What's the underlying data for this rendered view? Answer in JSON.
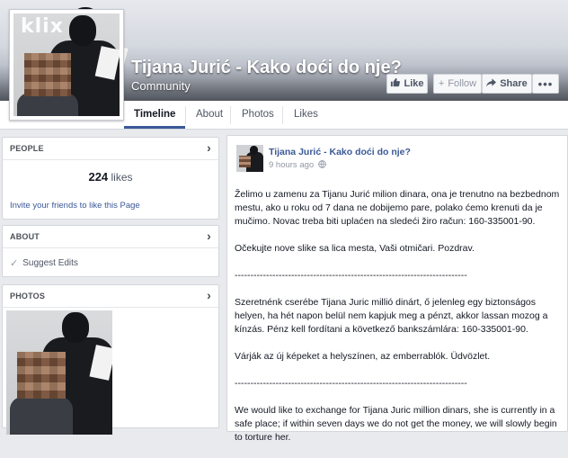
{
  "cover": {
    "logo_text": "klix",
    "page_name": "Tijana Jurić - Kako doći do nje?",
    "category": "Community"
  },
  "actions": {
    "like": "Like",
    "follow": "Follow",
    "share": "Share"
  },
  "tabs": [
    {
      "label": "Timeline",
      "active": true
    },
    {
      "label": "About",
      "active": false
    },
    {
      "label": "Photos",
      "active": false
    },
    {
      "label": "Likes",
      "active": false
    }
  ],
  "sidebar": {
    "people": {
      "header": "PEOPLE",
      "likes_number": "224",
      "likes_word": "likes",
      "invite_text": "Invite your friends to like this Page"
    },
    "about": {
      "header": "ABOUT",
      "suggest_edits": "Suggest Edits"
    },
    "photos": {
      "header": "PHOTOS"
    }
  },
  "post": {
    "author": "Tijana Jurić - Kako doći do nje?",
    "time": "9 hours ago",
    "paragraphs": [
      "Želimo u zamenu za Tijanu Jurić milion dinara, ona je trenutno na bezbednom mestu, ako u roku od 7 dana ne dobijemo pare, polako ćemo krenuti da je mučimo. Novac treba biti uplaćen na sledeći žiro račun: 160-335001-90.",
      "Očekujte nove slike sa lica mesta, Vaši otmičari. Pozdrav.",
      "--------------------------------------------------------------------------",
      "Szeretnénk cserébe Tijana Juric millió dinárt, ő jelenleg egy biztonságos helyen, ha hét napon belül nem kapjuk meg a pénzt, akkor lassan mozog a kínzás. Pénz kell fordítani a következő bankszámlára: 160-335001-90.",
      "Várják az új képeket a helyszínen, az emberrablók. Üdvözlet.",
      "--------------------------------------------------------------------------",
      "We would like to exchange for Tijana Juric million dinars, she is currently in a safe place; if within seven days we do not get the money, we will slowly begin to torture her."
    ]
  },
  "colors": {
    "brand": "#3b5998",
    "background": "#e9eaed",
    "border": "#d3d6db"
  },
  "icons": [
    "thumbs-up-icon",
    "plus-icon",
    "share-arrow-icon",
    "more-dots-icon",
    "chevron-right-icon",
    "checkmark-icon",
    "globe-icon"
  ]
}
